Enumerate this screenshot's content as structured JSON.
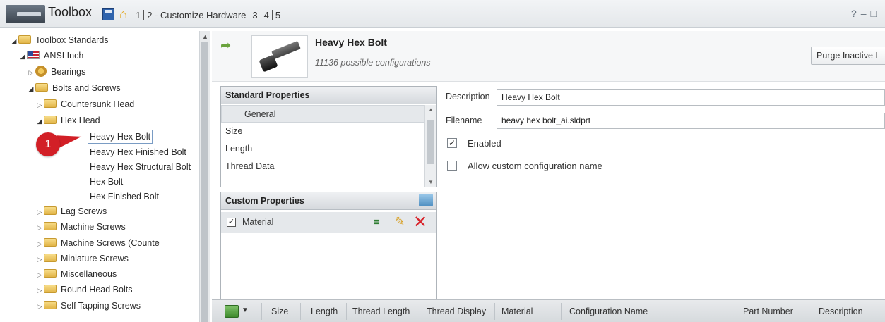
{
  "titlebar": {
    "app_title": "Toolbox",
    "crumb_1": "1",
    "crumb_2": "2 - Customize Hardware",
    "crumb_3": "3",
    "crumb_4": "4",
    "crumb_5": "5"
  },
  "tree": {
    "items": [
      {
        "label": "Toolbox Standards"
      },
      {
        "label": "ANSI Inch"
      },
      {
        "label": "Bearings"
      },
      {
        "label": "Bolts and Screws"
      },
      {
        "label": "Countersunk Head"
      },
      {
        "label": "Hex Head"
      },
      {
        "label": "Heavy Hex Bolt"
      },
      {
        "label": "Heavy Hex Finished Bolt"
      },
      {
        "label": "Heavy Hex Structural Bolt"
      },
      {
        "label": "Hex Bolt"
      },
      {
        "label": "Hex Finished Bolt"
      },
      {
        "label": "Lag Screws"
      },
      {
        "label": "Machine Screws"
      },
      {
        "label": "Machine Screws (Counte"
      },
      {
        "label": "Miniature Screws"
      },
      {
        "label": "Miscellaneous"
      },
      {
        "label": "Round Head Bolts"
      },
      {
        "label": "Self Tapping Screws"
      }
    ],
    "callout_number": "1"
  },
  "header": {
    "part_title": "Heavy Hex Bolt",
    "part_subtitle": "11136 possible configurations",
    "purge_button": "Purge Inactive I"
  },
  "standard_properties": {
    "title": "Standard Properties",
    "items": [
      "General",
      "Size",
      "Length",
      "Thread Data"
    ]
  },
  "custom_properties": {
    "title": "Custom Properties",
    "rows": [
      {
        "label": "Material",
        "checked": true
      }
    ]
  },
  "form": {
    "description_label": "Description",
    "description_value": "Heavy Hex Bolt",
    "filename_label": "Filename",
    "filename_value": "heavy hex bolt_ai.sldprt",
    "enabled_label": "Enabled",
    "enabled_checked": true,
    "allow_custom_label": "Allow custom configuration name",
    "allow_custom_checked": false
  },
  "grid": {
    "columns": [
      "Size",
      "Length",
      "Thread Length",
      "Thread Display",
      "Material",
      "Configuration Name",
      "Part Number",
      "Description"
    ]
  }
}
